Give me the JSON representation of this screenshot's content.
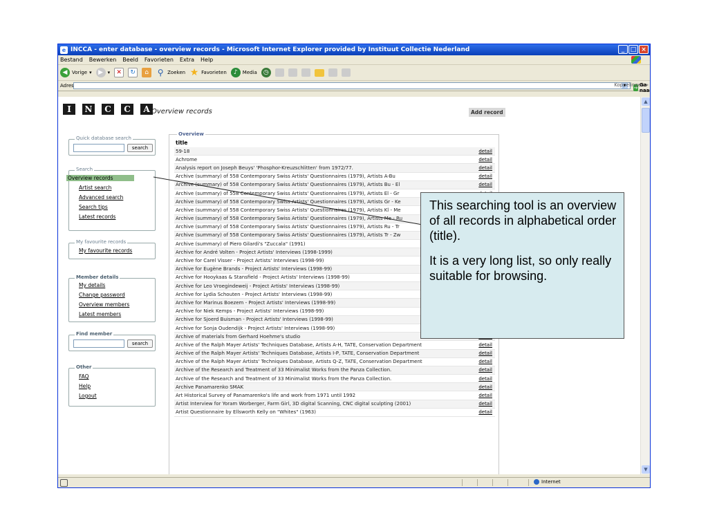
{
  "window": {
    "title": "INCCA - enter database - overview records - Microsoft Internet Explorer provided by Instituut Collectie Nederland",
    "controls": [
      "_",
      "□",
      "×"
    ]
  },
  "menubar": [
    "Bestand",
    "Bewerken",
    "Beeld",
    "Favorieten",
    "Extra",
    "Help"
  ],
  "toolbar": {
    "back": "Vorige",
    "search": "Zoeken",
    "favorites": "Favorieten",
    "media": "Media"
  },
  "addressbar": {
    "label": "Adres",
    "value": "",
    "go": "Ga naar",
    "links": "Koppelingen"
  },
  "statusbar": {
    "zone": "Internet"
  },
  "logo": [
    "I",
    "N",
    "C",
    "C",
    "A"
  ],
  "sidebar": {
    "quick_search": {
      "legend": "Quick database search",
      "button": "search"
    },
    "search": {
      "legend": "Search",
      "items": [
        "Overview records",
        "Artist search",
        "Advanced search",
        "Search tips",
        "Latest records"
      ]
    },
    "favourites": {
      "legend": "My favourite records",
      "items": [
        "My favourite records"
      ]
    },
    "member": {
      "legend": "Member details",
      "items": [
        "My details",
        "Change password",
        "Overview members",
        "Latest members"
      ]
    },
    "find_member": {
      "legend": "Find member",
      "button": "search"
    },
    "other": {
      "legend": "Other",
      "items": [
        "FAQ",
        "Help",
        "Logout"
      ]
    }
  },
  "main": {
    "page_title": "Overview records",
    "add_record": "Add record",
    "overview_legend": "Overview",
    "column_title": "title",
    "detail_label": "detail",
    "rows": [
      "59-18",
      "Achrome",
      "Analysis report on Joseph Beuys' 'Phosphor-Kreuzschlitten' from 1972/77.",
      "Archive (summary) of 558 Contemporary Swiss Artists' Questionnaires (1979), Artists A-Bu",
      "Archive (summary) of 558 Contemporary Swiss Artists' Questionnaires (1979), Artists Bu - El",
      "Archive (summary) of 558 Contemporary Swiss Artists' Questionnaires (1979), Artists El - Gr",
      "Archive (summary) of 558 Contemporary Swiss Artists' Questionnaires (1979), Artists Gr - Ke",
      "Archive (summary) of 558 Contemporary Swiss Artists' Questionnaires (1979), Artists Kl - Me",
      "Archive (summary) of 558 Contemporary Swiss Artists' Questionnaires (1979), Artists Me - Ru",
      "Archive (summary) of 558 Contemporary Swiss Artists' Questionnaires (1979), Artists Ru - Tr",
      "Archive (summary) of 558 Contemporary Swiss Artists' Questionnaires (1979), Artists Tr - Zw",
      "Archive (summary) of Piero Gilardi's \"Zuccala\" (1991)",
      "Archive for André Volten - Project Artists' Interviews (1998-1999)",
      "Archive for Carel Visser - Project Artists' Interviews (1998-99)",
      "Archive for Eugène Brands - Project Artists' Interviews (1998-99)",
      "Archive for Hooykaas & Stansfield - Project Artists' Interviews (1998-99)",
      "Archive for Leo Vroegindeweij - Project Artists' Interviews (1998-99)",
      "Archive for Lydia Schouten - Project Artists' Interviews (1998-99)",
      "Archive for Marinus Boezem - Project Artists' Interviews (1998-99)",
      "Archive for Niek Kemps - Project Artists' Interviews (1998-99)",
      "Archive for Sjoerd Buisman - Project Artists' Interviews (1998-99)",
      "Archive for Sonja Oudendijk - Project Artists' Interviews (1998-99)",
      "Archive of materials from Gerhard Hoehme's studio",
      "Archive of the Ralph Mayer Artists' Techniques Database, Artists A-H, TATE, Conservation Department",
      "Archive of the Ralph Mayer Artists' Techniques Database, Artists I-P, TATE, Conservation Department",
      "Archive of the Ralph Mayer Artists' Techniques Database, Artists Q-Z, TATE, Conservation Department",
      "Archive of the Research and Treatment of 33 Minimalist Works from the Panza Collection.",
      "Archive of the Research and Treatment of 33 Minimalist Works from the Panza Collection.",
      "Archive Panamarenko SMAK",
      "Art Historical Survey of Panamarenko's life and work from 1971 until 1992",
      "Artist Interview for Yoram Worberger, Farm Girl, 3D digital Scanning, CNC digital sculpting (2001)",
      "Artist Questionnaire by Ellsworth Kelly on \"Whites\" (1963)"
    ]
  },
  "callout": {
    "paragraph1": "This searching tool is an overview of all records in alphabetical order (title).",
    "paragraph2": "It is a very long list, so only really suitable for browsing."
  },
  "colors": {
    "titlebar": "#0A3FB8",
    "chrome": "#ECE9D8",
    "active_nav": "#8fbe8a",
    "callout_bg": "#D7EBEF"
  }
}
